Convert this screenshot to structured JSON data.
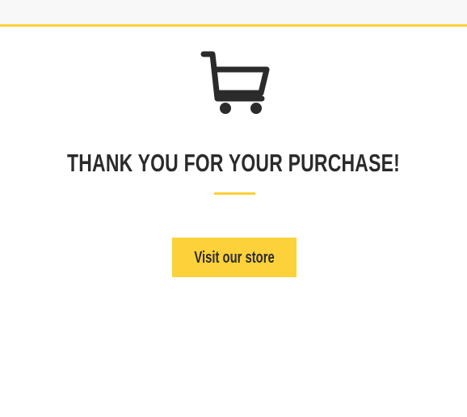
{
  "header": {
    "accent_color": "#fdd13a",
    "background_color": "#f8f8f8"
  },
  "hero": {
    "icon": "shopping-cart-icon",
    "title": "THANK YOU FOR YOUR PURCHASE!",
    "title_color": "#2b2b2b"
  },
  "cta": {
    "label": "Visit our store",
    "background_color": "#fdd13a"
  }
}
